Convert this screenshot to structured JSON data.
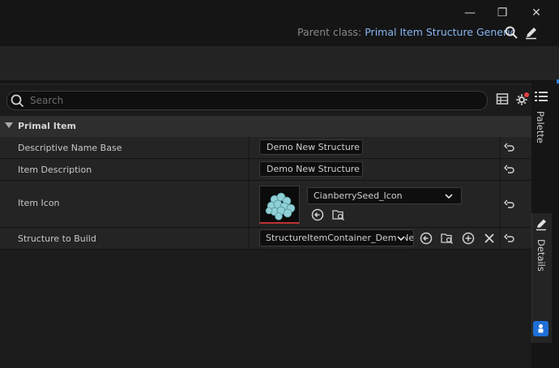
{
  "window": {
    "minimize_glyph": "—",
    "restore_glyph": "❐",
    "close_glyph": "✕"
  },
  "header": {
    "parent_class_label": "Parent class:",
    "parent_class_value": "Primal Item Structure Generic"
  },
  "details": {
    "search_placeholder": "Search",
    "category": "Primal Item",
    "rows": [
      {
        "name": "Descriptive Name Base",
        "value": "Demo New Structure"
      },
      {
        "name": "Item Description",
        "value": "Demo New Structure"
      },
      {
        "name": "Item Icon",
        "value": "CianberrySeed_Icon"
      },
      {
        "name": "Structure to Build",
        "value": "StructureItemContainer_DemoNewStructure"
      }
    ]
  },
  "tabs": {
    "palette": "Palette",
    "details": "Details"
  },
  "colors": {
    "accent": "#86b6f0",
    "badge": "#1f6fd6",
    "notify_dot": "#e04040"
  },
  "icons": [
    "search-icon",
    "table-view-icon",
    "settings-gear-icon",
    "reset-arrow-icon",
    "use-selected-icon",
    "browse-icon",
    "add-icon",
    "clear-icon",
    "pencil-icon",
    "list-icon",
    "chevron-down-icon"
  ]
}
